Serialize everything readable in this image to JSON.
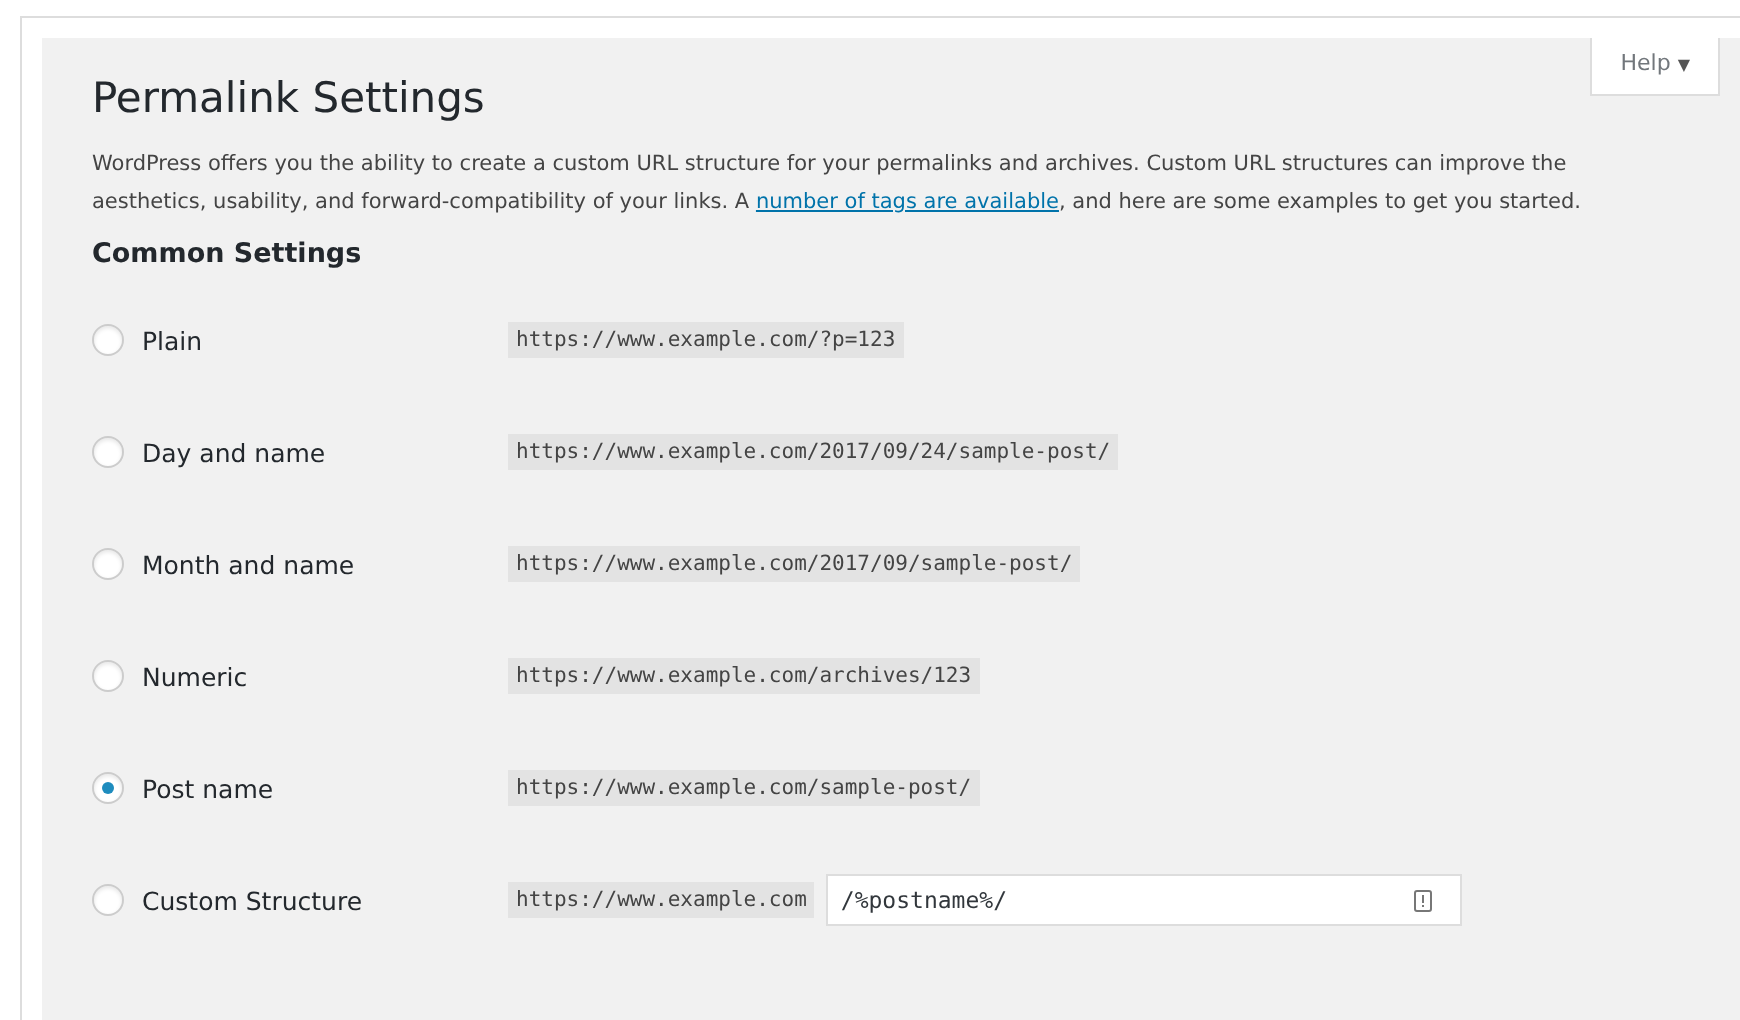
{
  "help_button": {
    "label": "Help",
    "caret": "▼"
  },
  "title": "Permalink Settings",
  "intro": {
    "before": "WordPress offers you the ability to create a custom URL structure for your permalinks and archives. Custom URL structures can improve the aesthetics, usability, and forward-compatibility of your links. A ",
    "link": "number of tags are available",
    "after": ", and here are some examples to get you started."
  },
  "section_title": "Common Settings",
  "options": [
    {
      "kind": "example",
      "label": "Plain",
      "selected": false,
      "url": "https://www.example.com/?p=123"
    },
    {
      "kind": "example",
      "label": "Day and name",
      "selected": false,
      "url": "https://www.example.com/2017/09/24/sample-post/"
    },
    {
      "kind": "example",
      "label": "Month and name",
      "selected": false,
      "url": "https://www.example.com/2017/09/sample-post/"
    },
    {
      "kind": "example",
      "label": "Numeric",
      "selected": false,
      "url": "https://www.example.com/archives/123"
    },
    {
      "kind": "example",
      "label": "Post name",
      "selected": true,
      "url": "https://www.example.com/sample-post/"
    },
    {
      "kind": "custom",
      "label": "Custom Structure",
      "selected": false,
      "url": "https://www.example.com",
      "value": "/%postname%/"
    }
  ]
}
